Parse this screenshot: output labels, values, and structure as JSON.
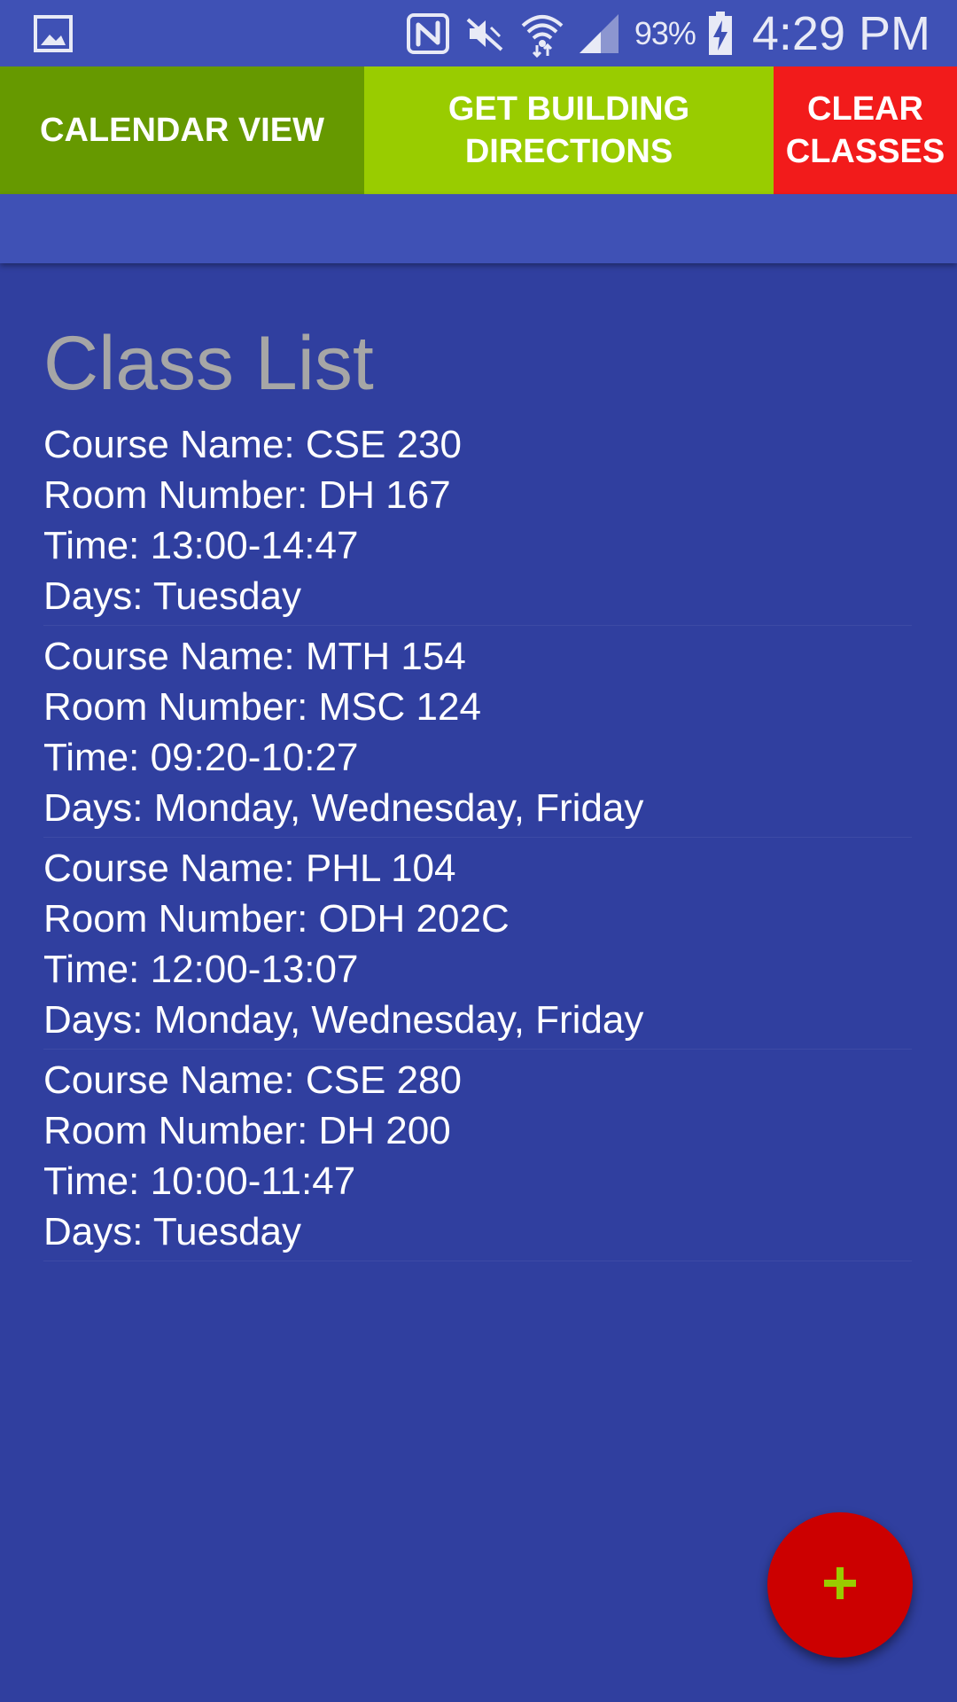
{
  "status_bar": {
    "icons": [
      "gallery-icon",
      "nfc-icon",
      "mute-icon",
      "wifi-icon",
      "signal-icon",
      "battery-charging-icon"
    ],
    "battery_percent": "93%",
    "time": "4:29 PM"
  },
  "toolbar": {
    "calendar_label": "CALENDAR VIEW",
    "directions_label": "GET BUILDING\nDIRECTIONS",
    "clear_label": "CLEAR\nCLASSES",
    "colors": {
      "calendar": "#669900",
      "directions": "#99cc00",
      "clear": "#f21b1b"
    }
  },
  "page": {
    "title": "Class List"
  },
  "classes": [
    {
      "course": "Course Name: CSE 230",
      "room": "Room Number: DH 167",
      "time": "Time: 13:00-14:47",
      "days": "Days: Tuesday"
    },
    {
      "course": "Course Name: MTH 154",
      "room": "Room Number: MSC 124",
      "time": "Time: 09:20-10:27",
      "days": "Days: Monday, Wednesday, Friday"
    },
    {
      "course": "Course Name: PHL 104",
      "room": "Room Number: ODH 202C",
      "time": "Time: 12:00-13:07",
      "days": "Days: Monday, Wednesday, Friday"
    },
    {
      "course": "Course Name: CSE 280",
      "room": "Room Number: DH 200",
      "time": "Time: 10:00-11:47",
      "days": "Days: Tuesday"
    }
  ],
  "fab": {
    "icon": "plus-icon",
    "color": "#cc0000",
    "icon_color": "#99cc00"
  },
  "theme": {
    "primary": "#3f51b5",
    "background": "#303f9f"
  }
}
